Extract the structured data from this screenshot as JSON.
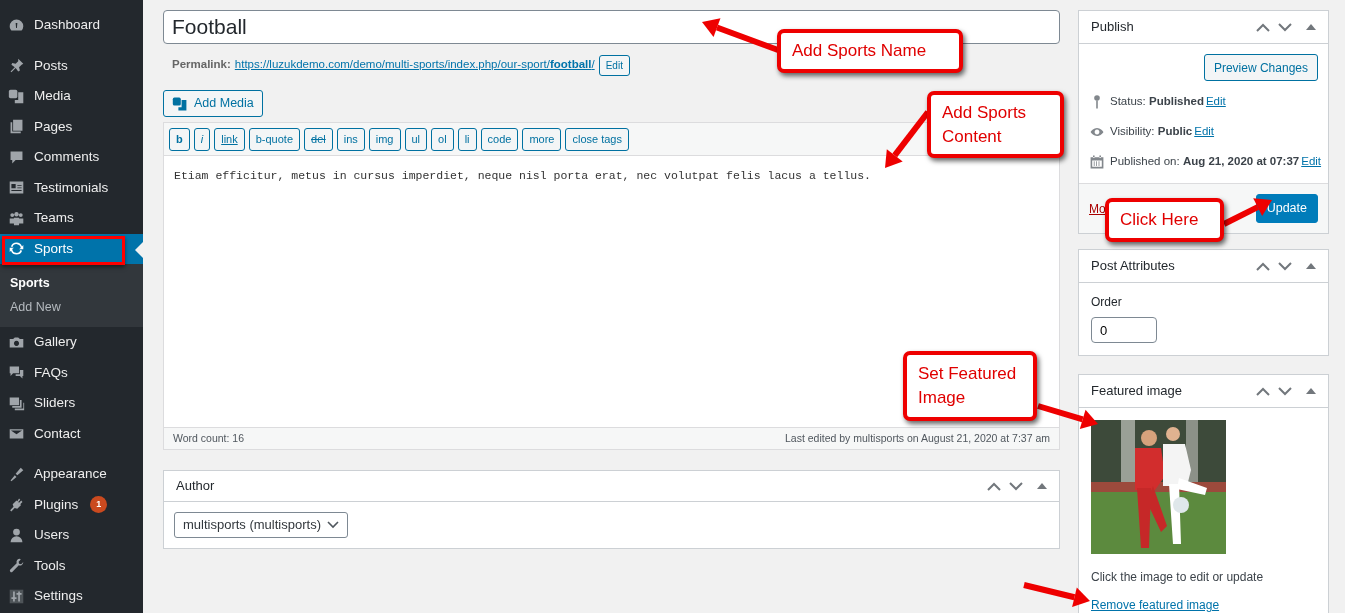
{
  "sidebar": {
    "groups": [
      [
        {
          "label": "Dashboard",
          "selected": false
        }
      ],
      [
        {
          "label": "Posts",
          "selected": false
        },
        {
          "label": "Media",
          "selected": false
        },
        {
          "label": "Pages",
          "selected": false
        },
        {
          "label": "Comments",
          "selected": false
        },
        {
          "label": "Testimonials",
          "selected": false
        },
        {
          "label": "Teams",
          "selected": false
        },
        {
          "label": "Sports",
          "selected": true,
          "submenu": [
            {
              "label": "Sports",
              "selected": true
            },
            {
              "label": "Add New",
              "selected": false
            }
          ]
        },
        {
          "label": "Gallery",
          "selected": false
        },
        {
          "label": "FAQs",
          "selected": false
        },
        {
          "label": "Sliders",
          "selected": false
        },
        {
          "label": "Contact",
          "selected": false
        }
      ],
      [
        {
          "label": "Appearance",
          "selected": false
        },
        {
          "label": "Plugins",
          "selected": false,
          "badge": "1"
        },
        {
          "label": "Users",
          "selected": false
        },
        {
          "label": "Tools",
          "selected": false
        },
        {
          "label": "Settings",
          "selected": false
        }
      ]
    ]
  },
  "title_field": {
    "value": "Football"
  },
  "permalink": {
    "label": "Permalink:",
    "url": "https://luzukdemo.com/demo/multi-sports/index.php/our-sport/**football**/",
    "edit_button": "Edit"
  },
  "add_media_button": "Add Media",
  "quicktags": [
    {
      "label": "b",
      "kind": "bold"
    },
    {
      "label": "i",
      "kind": "italic"
    },
    {
      "label": "link",
      "kind": "link"
    },
    {
      "label": "b-quote",
      "kind": "plain"
    },
    {
      "label": "del",
      "kind": "strike"
    },
    {
      "label": "ins",
      "kind": "plain"
    },
    {
      "label": "img",
      "kind": "plain"
    },
    {
      "label": "ul",
      "kind": "plain"
    },
    {
      "label": "ol",
      "kind": "plain"
    },
    {
      "label": "li",
      "kind": "plain"
    },
    {
      "label": "code",
      "kind": "plain"
    },
    {
      "label": "more",
      "kind": "plain"
    },
    {
      "label": "close tags",
      "kind": "plain"
    }
  ],
  "editor": {
    "content": "Etiam efficitur, metus in cursus imperdiet, neque nisl porta erat, nec volutpat felis lacus a tellus.",
    "word_count": "Word count: 16",
    "last_edited": "Last edited by multisports on August 21, 2020 at 7:37 am"
  },
  "author_box": {
    "title": "Author",
    "select": "multisports (multisports)"
  },
  "publish_box": {
    "title": "Publish",
    "preview_button": "Preview Changes",
    "rows": [
      {
        "text": "Status: **Published**",
        "link": "Edit"
      },
      {
        "text": "Visibility: **Public**",
        "link": "Edit"
      },
      {
        "text": "Published on: **Aug 21, 2020 at 07:37**",
        "link": "Edit"
      }
    ],
    "trash_link": "Mo",
    "update_button": "Update"
  },
  "attributes_box": {
    "title": "Post Attributes",
    "order_label": "Order",
    "order_value": "0"
  },
  "featured_box": {
    "title": "Featured image",
    "hint": "Click the image to edit or update",
    "remove_link": "Remove featured image"
  },
  "annotations": [
    {
      "text": "Add Sports Name"
    },
    {
      "text": "Add Sports Content"
    },
    {
      "text": "Click Here"
    },
    {
      "text": "Set Featured Image"
    }
  ]
}
